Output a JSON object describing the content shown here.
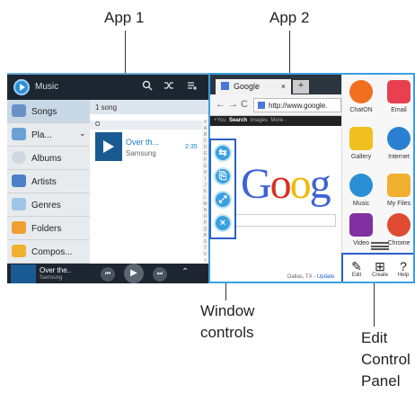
{
  "callouts": {
    "app1": "App 1",
    "app2": "App 2",
    "window_controls_1": "Window",
    "window_controls_2": "controls",
    "edit_panel_1": "Edit",
    "edit_panel_2": "Control",
    "edit_panel_3": "Panel"
  },
  "app1": {
    "title": "Music",
    "sidebar": [
      {
        "label": "Songs",
        "color": "#6a90c8"
      },
      {
        "label": "Pla...",
        "color": "#6aa0d4"
      },
      {
        "label": "Albums",
        "color": "#cfd8e0"
      },
      {
        "label": "Artists",
        "color": "#4a80c8"
      },
      {
        "label": "Genres",
        "color": "#9fc6e8"
      },
      {
        "label": "Folders",
        "color": "#f0a030"
      },
      {
        "label": "Compos...",
        "color": "#f0b030"
      }
    ],
    "count": "1 song",
    "section": "O",
    "song": {
      "title": "Over th...",
      "artist": "Samsung",
      "duration": "2:35"
    },
    "alpha_index": [
      "#",
      "A",
      "B",
      "C",
      "D",
      "E",
      "F",
      "G",
      "H",
      "I",
      "J",
      "K",
      "L",
      "M",
      "N",
      "O",
      "P",
      "Q",
      "R",
      "S",
      "T",
      "U",
      "V",
      "W",
      "X",
      "Y",
      "Z"
    ],
    "player": {
      "title": "Over the..",
      "artist": "Samsung",
      "thumb_label": "SAMSUNG"
    }
  },
  "app2": {
    "tab_title": "Google",
    "tab_close": "×",
    "new_tab": "+",
    "back": "←",
    "forward": "→",
    "refresh": "C",
    "url": "http://www.google.",
    "gbar": {
      "you": "+You",
      "search": "Search",
      "images": "Images",
      "more": "More -"
    },
    "logo_letters": [
      "G",
      "o",
      "o",
      "g"
    ],
    "logo_colors": [
      "#3b63d4",
      "#d93025",
      "#f1b900",
      "#3b63d4"
    ],
    "footer_location": "Dallas, TX - ",
    "footer_update": "Update",
    "tray_apps": [
      {
        "label": "ChatON",
        "color": "#f07020"
      },
      {
        "label": "Email",
        "color": "#e84050"
      },
      {
        "label": "Gallery",
        "color": "#f0c020"
      },
      {
        "label": "Internet",
        "color": "#2a80d0"
      },
      {
        "label": "Music",
        "color": "#2a8fd4"
      },
      {
        "label": "My Files",
        "color": "#f0b030"
      },
      {
        "label": "Video",
        "color": "#8030a0"
      },
      {
        "label": "Chrome",
        "color": "#e04a30"
      }
    ],
    "edit_panel": {
      "edit": "Edit",
      "create": "Create",
      "help": "Help"
    }
  },
  "window_controls": {
    "switch_glyph": "⇆",
    "share_glyph": "⎘",
    "maximize_glyph": "⤢",
    "close_glyph": "×"
  }
}
